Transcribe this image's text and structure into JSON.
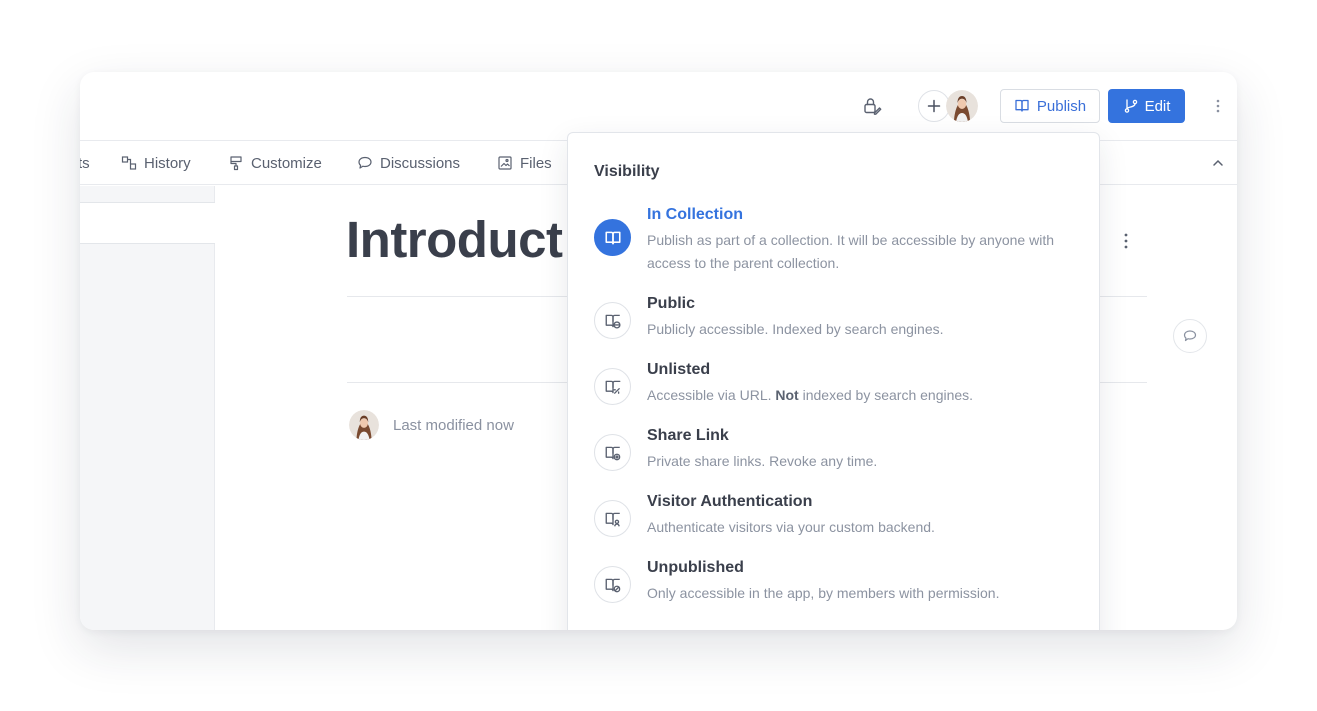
{
  "topbar": {
    "publish_label": "Publish",
    "edit_label": "Edit"
  },
  "tabs": [
    {
      "label": "ts"
    },
    {
      "label": "History"
    },
    {
      "label": "Customize"
    },
    {
      "label": "Discussions"
    },
    {
      "label": "Files"
    }
  ],
  "document": {
    "title": "Introduct",
    "last_modified": "Last modified now"
  },
  "visibility": {
    "heading": "Visibility",
    "options": [
      {
        "title": "In Collection",
        "description": "Publish as part of a collection. It will be accessible by anyone with access to the parent collection.",
        "active": true
      },
      {
        "title": "Public",
        "description": "Publicly accessible. Indexed by search engines.",
        "active": false
      },
      {
        "title": "Unlisted",
        "description_before": "Accessible via URL. ",
        "description_bold": "Not",
        "description_after": " indexed by search engines.",
        "active": false
      },
      {
        "title": "Share Link",
        "description": "Private share links. Revoke any time.",
        "active": false
      },
      {
        "title": "Visitor Authentication",
        "description": "Authenticate visitors via your custom backend.",
        "active": false
      },
      {
        "title": "Unpublished",
        "description": "Only accessible in the app, by members with permission.",
        "active": false
      }
    ]
  },
  "colors": {
    "accent": "#3473de",
    "text": "#3a3f4b",
    "muted": "#8c93a1"
  }
}
